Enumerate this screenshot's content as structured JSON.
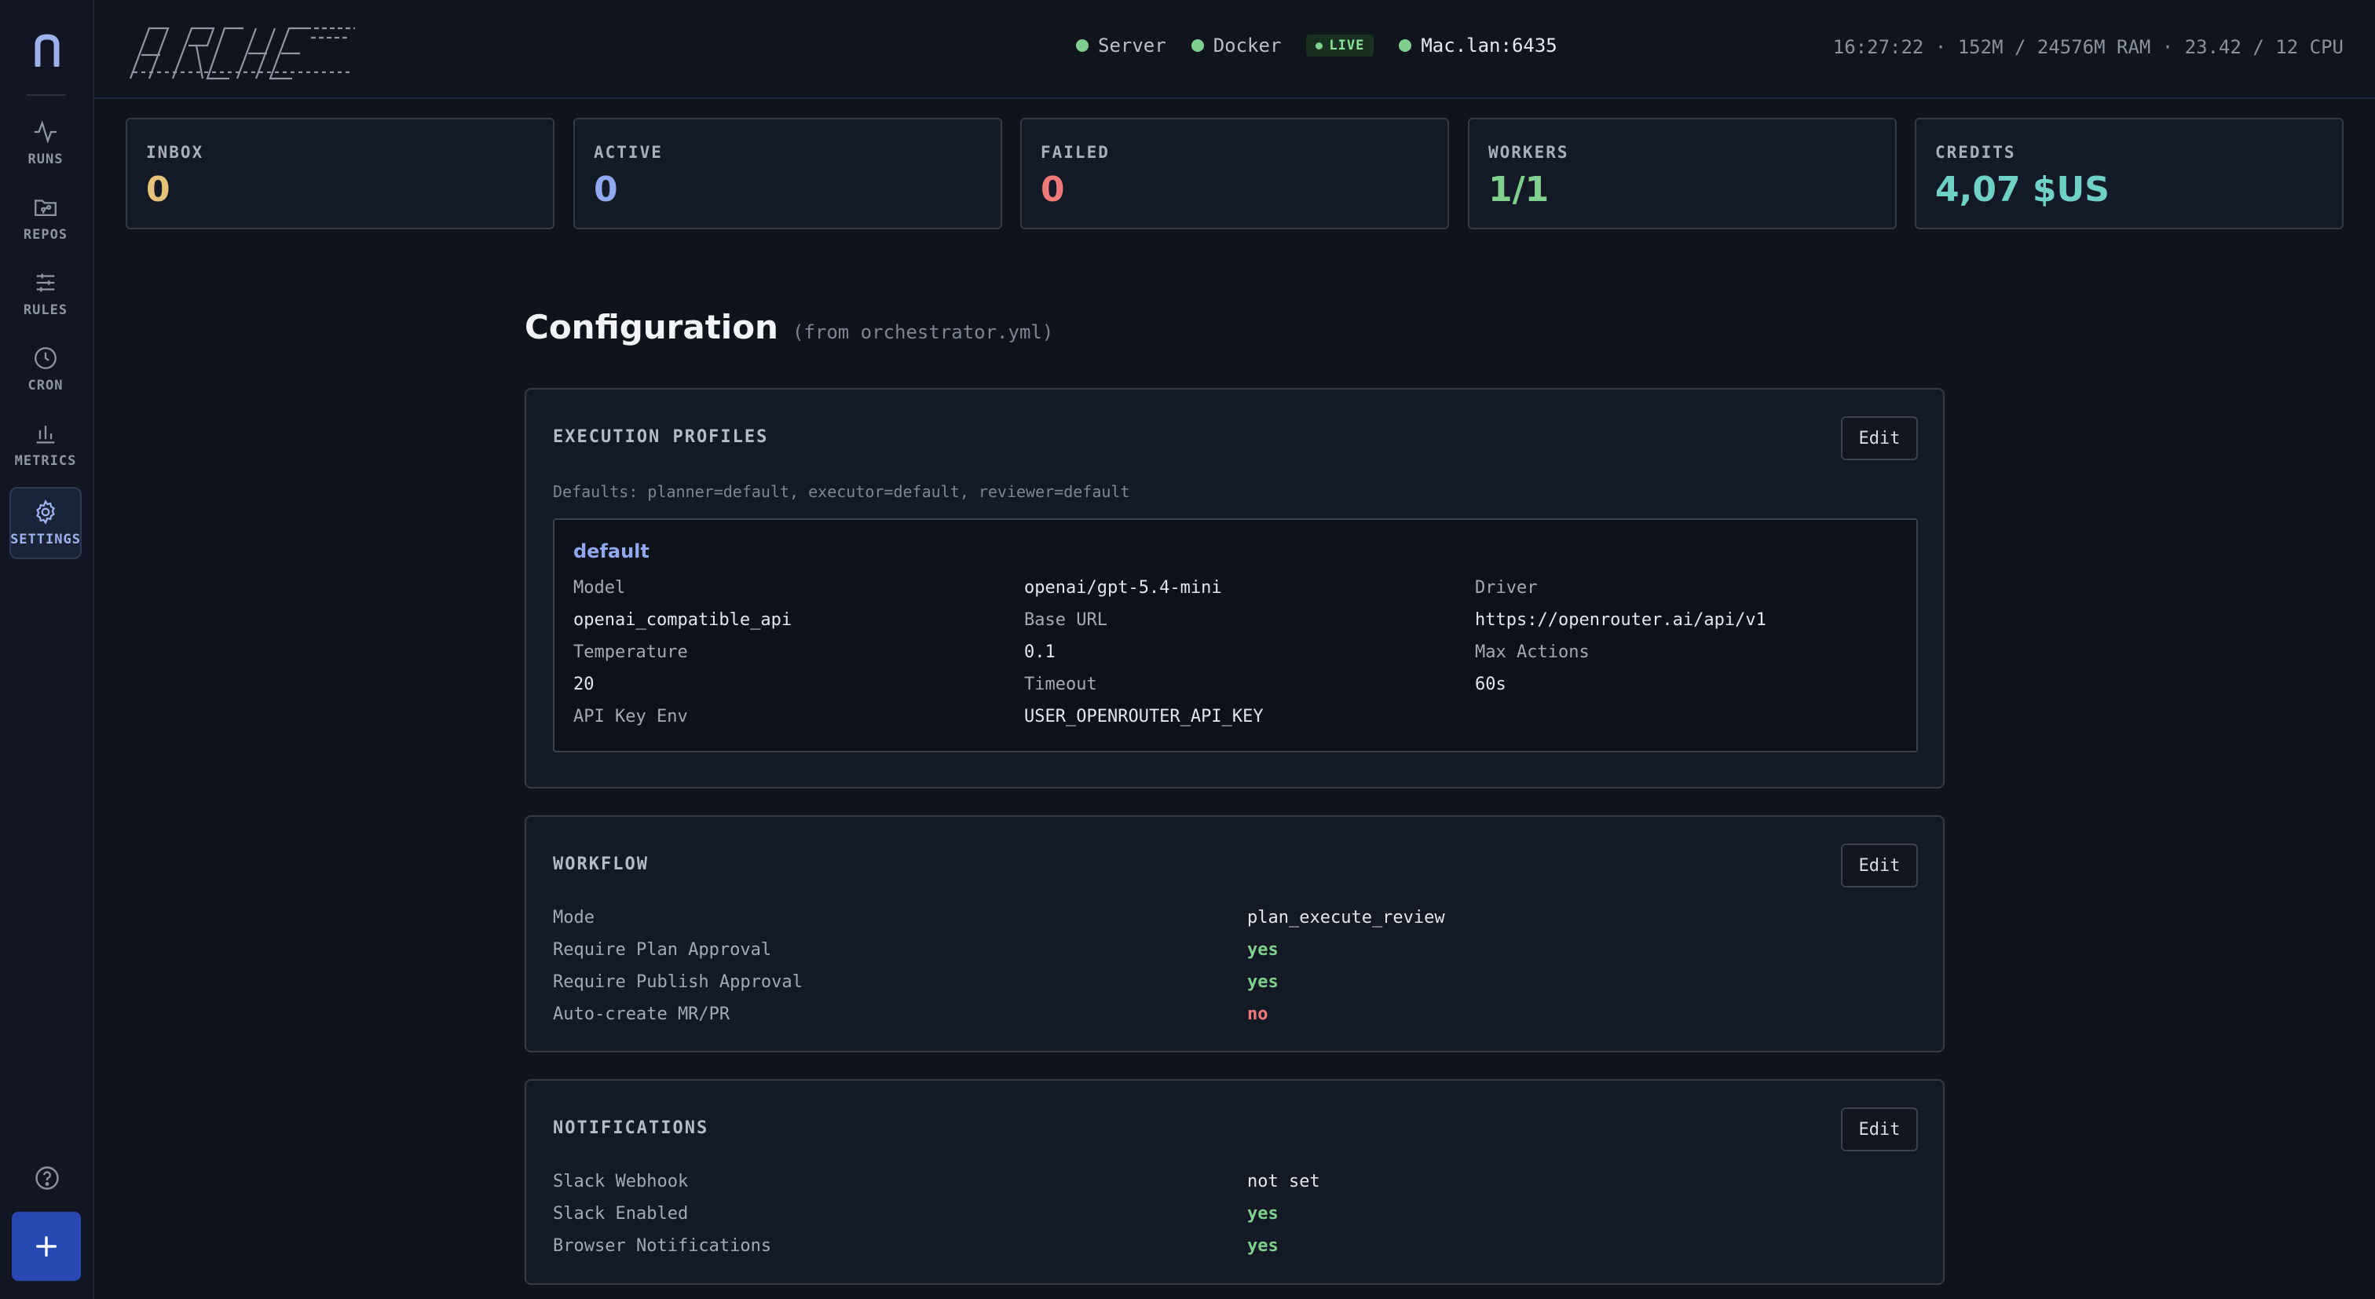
{
  "brand": {
    "name": "ARCHE"
  },
  "sidebar": {
    "items": [
      {
        "label": "RUNS",
        "icon": "activity-icon"
      },
      {
        "label": "REPOS",
        "icon": "folder-git-icon"
      },
      {
        "label": "RULES",
        "icon": "sliders-icon"
      },
      {
        "label": "CRON",
        "icon": "clock-icon"
      },
      {
        "label": "METRICS",
        "icon": "bar-chart-icon"
      },
      {
        "label": "SETTINGS",
        "icon": "gear-icon",
        "active": true
      }
    ],
    "help_icon": "help-circle-icon",
    "add_icon": "plus-icon"
  },
  "topbar": {
    "server_label": "Server",
    "docker_label": "Docker",
    "live_label": "LIVE",
    "host": "Mac.lan:6435",
    "sysinfo": "16:27:22 · 152M / 24576M RAM · 23.42 / 12 CPU"
  },
  "stats": [
    {
      "label": "INBOX",
      "value": "0",
      "color": "#e9c27a"
    },
    {
      "label": "ACTIVE",
      "value": "0",
      "color": "#8fa8f0"
    },
    {
      "label": "FAILED",
      "value": "0",
      "color": "#f07a7a"
    },
    {
      "label": "WORKERS",
      "value": "1/1",
      "color": "#7fd08e"
    },
    {
      "label": "CREDITS",
      "value": "4,07 $US",
      "color": "#6fd0c6"
    }
  ],
  "page": {
    "title": "Configuration",
    "subtitle": "(from orchestrator.yml)"
  },
  "execution_profiles": {
    "title": "EXECUTION PROFILES",
    "edit_label": "Edit",
    "defaults": "Defaults: planner=default, executor=default, reviewer=default",
    "profile": {
      "name": "default",
      "grid": [
        [
          "Model",
          "openai/gpt-5.4-mini",
          "Driver"
        ],
        [
          "openai_compatible_api",
          "Base URL",
          "https://openrouter.ai/api/v1"
        ],
        [
          "Temperature",
          "0.1",
          "Max Actions"
        ],
        [
          "20",
          "Timeout",
          "60s"
        ],
        [
          "API Key Env",
          "USER_OPENROUTER_API_KEY",
          ""
        ]
      ]
    }
  },
  "workflow": {
    "title": "WORKFLOW",
    "edit_label": "Edit",
    "rows": [
      {
        "key": "Mode",
        "value": "plan_execute_review",
        "kind": "text"
      },
      {
        "key": "Require Plan Approval",
        "value": "yes",
        "kind": "yes"
      },
      {
        "key": "Require Publish Approval",
        "value": "yes",
        "kind": "yes"
      },
      {
        "key": "Auto-create MR/PR",
        "value": "no",
        "kind": "no"
      }
    ]
  },
  "notifications": {
    "title": "NOTIFICATIONS",
    "edit_label": "Edit",
    "rows": [
      {
        "key": "Slack Webhook",
        "value": "not set",
        "kind": "text"
      },
      {
        "key": "Slack Enabled",
        "value": "yes",
        "kind": "yes"
      },
      {
        "key": "Browser Notifications",
        "value": "yes",
        "kind": "yes"
      }
    ]
  }
}
